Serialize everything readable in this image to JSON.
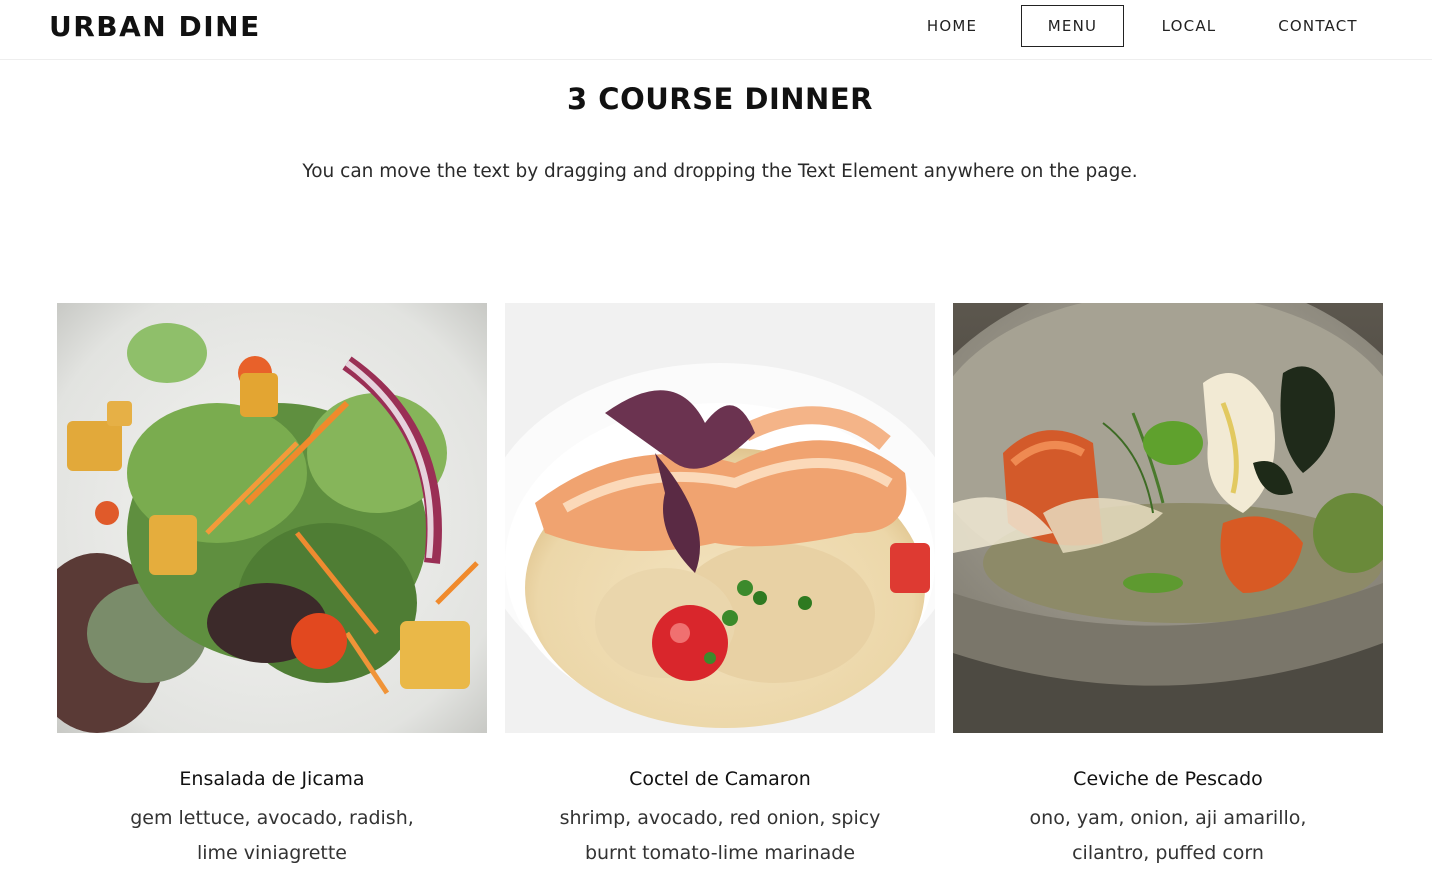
{
  "header": {
    "brand": "URBAN DINE",
    "nav": [
      {
        "label": "HOME",
        "active": false
      },
      {
        "label": "MENU",
        "active": true
      },
      {
        "label": "LOCAL",
        "active": false
      },
      {
        "label": "CONTACT",
        "active": false
      }
    ]
  },
  "main": {
    "title": "3 COURSE DINNER",
    "intro": "You can move the text by dragging and dropping the Text Element anywhere on the page.",
    "dishes": [
      {
        "name": "Ensalada de Jicama",
        "desc_line1": "gem lettuce, avocado, radish,",
        "desc_line2": "lime viniagrette"
      },
      {
        "name": "Coctel de Camaron",
        "desc_line1": "shrimp, avocado, red onion, spicy",
        "desc_line2": "burnt tomato-lime marinade"
      },
      {
        "name": "Ceviche de Pescado",
        "desc_line1": "ono, yam, onion, aji amarillo,",
        "desc_line2": "cilantro, puffed corn"
      }
    ]
  },
  "colors": {
    "text": "#111111",
    "active_border": "#222222",
    "divider": "#eeeeee"
  }
}
